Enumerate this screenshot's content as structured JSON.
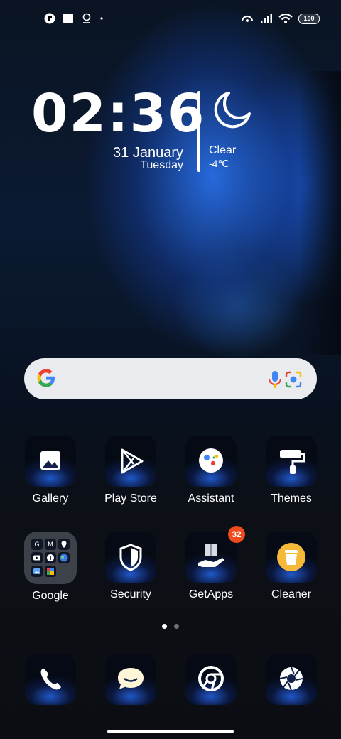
{
  "status_bar": {
    "left_icons": [
      "app-notification-icon",
      "square-notification-icon",
      "location-pin-icon",
      "dot-icon"
    ],
    "right_icons": [
      "hotspot-icon",
      "signal-icon",
      "wifi-icon"
    ],
    "battery": "100"
  },
  "clock_widget": {
    "time": "02:36",
    "date": "31  January",
    "weekday": "Tuesday",
    "weather_icon": "moon-icon",
    "condition": "Clear",
    "temperature": "-4℃"
  },
  "search_bar": {
    "icons": [
      "google-g-icon",
      "microphone-icon",
      "google-lens-icon"
    ]
  },
  "apps_row1": [
    {
      "label": "Gallery",
      "icon": "gallery-icon"
    },
    {
      "label": "Play Store",
      "icon": "play-store-icon"
    },
    {
      "label": "Assistant",
      "icon": "assistant-icon"
    },
    {
      "label": "Themes",
      "icon": "themes-icon"
    }
  ],
  "apps_row2": [
    {
      "label": "Google",
      "icon": "google-folder-icon"
    },
    {
      "label": "Security",
      "icon": "security-shield-icon"
    },
    {
      "label": "GetApps",
      "icon": "getapps-icon",
      "badge": "32"
    },
    {
      "label": "Cleaner",
      "icon": "cleaner-icon"
    }
  ],
  "google_folder_apps": [
    "G",
    "M",
    "maps",
    "yt",
    "i",
    "earth",
    "photos",
    "news"
  ],
  "page_indicator": {
    "pages": 2,
    "current": 1
  },
  "dock": [
    {
      "icon": "phone-icon"
    },
    {
      "icon": "messages-icon"
    },
    {
      "icon": "chrome-icon"
    },
    {
      "icon": "camera-icon"
    }
  ],
  "colors": {
    "badge": "#ee4c1f",
    "accent": "#2a62d9"
  }
}
